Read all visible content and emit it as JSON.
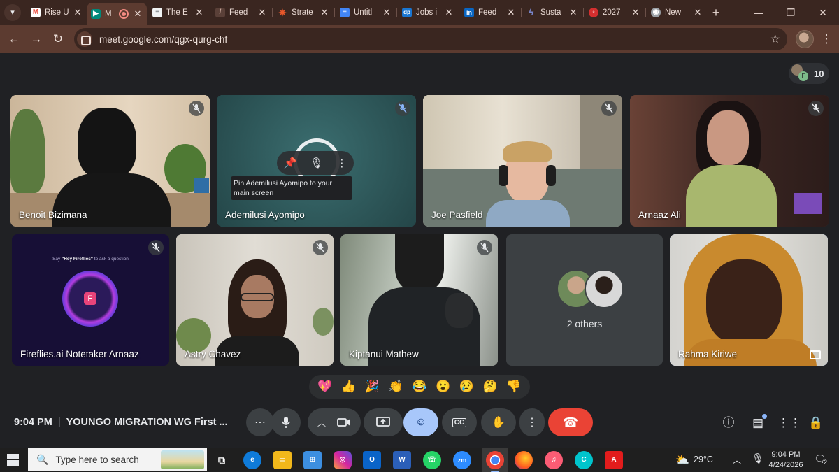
{
  "browser": {
    "tabs": [
      {
        "label": "Rise U",
        "favicon": "gmail-icon",
        "color": "#ea4335"
      },
      {
        "label": "M",
        "favicon": "meet-icon",
        "color": "#00897b",
        "active": true
      },
      {
        "label": "The E",
        "favicon": "page-icon",
        "color": "#5f6368"
      },
      {
        "label": "Feed",
        "favicon": "feed-icon",
        "color": "#5a4038"
      },
      {
        "label": "Strate",
        "favicon": "star-burst-icon",
        "color": "#e8572a"
      },
      {
        "label": "Untitl",
        "favicon": "docs-icon",
        "color": "#4285f4"
      },
      {
        "label": "Jobs i",
        "favicon": "jobs-icon",
        "color": "#1976d2"
      },
      {
        "label": "Feed",
        "favicon": "linkedin-icon",
        "color": "#0a66c2"
      },
      {
        "label": "Susta",
        "favicon": "bolt-icon",
        "color": "#5c6bc0"
      },
      {
        "label": "2027",
        "favicon": "red-circle-icon",
        "color": "#d32f2f"
      },
      {
        "label": "New",
        "favicon": "chrome-icon",
        "color": "#9aa0a6"
      }
    ],
    "url": "meet.google.com/qgx-qurg-chf"
  },
  "meet": {
    "participant_count": "10",
    "participants": [
      {
        "name": "Benoit Bizimana"
      },
      {
        "name": "Ademilusi Ayomipo"
      },
      {
        "name": "Joe Pasfield"
      },
      {
        "name": "Arnaaz Ali"
      },
      {
        "name": "Fireflies.ai Notetaker Arnaaz",
        "prompt_prefix": "Say ",
        "prompt_quote": "\"Hey Fireflies\"",
        "prompt_suffix": " to ask a question",
        "dots": "..."
      },
      {
        "name": "Astry Chavez"
      },
      {
        "name": "Kiptanui Mathew"
      },
      {
        "name": "Rahma Kiriwe"
      }
    ],
    "others_label": "2 others",
    "pin_tooltip": "Pin Ademilusi Ayomipo to your\nmain screen",
    "reactions": [
      "💖",
      "👍",
      "🎉",
      "👏",
      "😂",
      "😮",
      "😢",
      "🤔",
      "👎"
    ],
    "time": "9:04 PM",
    "meeting_title": "YOUNGO MIGRATION WG First ..."
  },
  "taskbar": {
    "search_placeholder": "Type here to search",
    "weather": "29°C",
    "clock_time": "9:04 PM",
    "clock_date": "4/24/2026",
    "notifications": "2"
  }
}
